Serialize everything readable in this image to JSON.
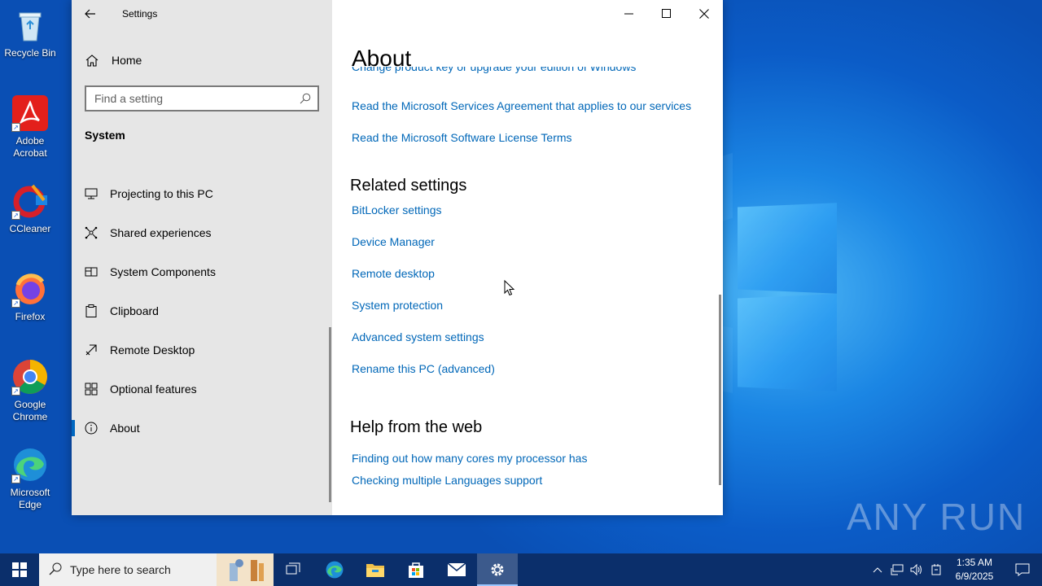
{
  "desktop": {
    "icons": [
      {
        "label": "Recycle Bin",
        "icon": "recycle-bin-icon"
      },
      {
        "label": "Adobe Acrobat",
        "icon": "adobe-acrobat-icon"
      },
      {
        "label": "CCleaner",
        "icon": "ccleaner-icon"
      },
      {
        "label": "Firefox",
        "icon": "firefox-icon"
      },
      {
        "label": "Google Chrome",
        "icon": "chrome-icon"
      },
      {
        "label": "Microsoft Edge",
        "icon": "edge-icon"
      }
    ],
    "watermark": "ANY RUN"
  },
  "settings": {
    "app_title": "Settings",
    "home_label": "Home",
    "search_placeholder": "Find a setting",
    "section": "System",
    "nav_items": [
      {
        "label": "Projecting to this PC",
        "icon": "projector-icon"
      },
      {
        "label": "Shared experiences",
        "icon": "shared-experiences-icon"
      },
      {
        "label": "System Components",
        "icon": "components-icon"
      },
      {
        "label": "Clipboard",
        "icon": "clipboard-icon"
      },
      {
        "label": "Remote Desktop",
        "icon": "remote-desktop-icon"
      },
      {
        "label": "Optional features",
        "icon": "optional-features-icon"
      },
      {
        "label": "About",
        "icon": "info-icon",
        "active": true
      }
    ],
    "page_title": "About",
    "cut_link": "Change product key or upgrade your edition of Windows",
    "top_links": [
      "Read the Microsoft Services Agreement that applies to our services",
      "Read the Microsoft Software License Terms"
    ],
    "related_heading": "Related settings",
    "related_links": [
      "BitLocker settings",
      "Device Manager",
      "Remote desktop",
      "System protection",
      "Advanced system settings",
      "Rename this PC (advanced)"
    ],
    "help_heading": "Help from the web",
    "help_links": [
      "Finding out how many cores my processor has",
      "Checking multiple Languages support"
    ]
  },
  "taskbar": {
    "search_text": "Type here to search",
    "apps": [
      "task-view-icon",
      "edge-icon",
      "file-explorer-icon",
      "store-icon",
      "mail-icon",
      "settings-gear-icon"
    ],
    "time": "1:35 AM",
    "date": "6/9/2025"
  },
  "colors": {
    "link": "#0067b8",
    "accent": "#0067c0",
    "taskbar": "#0b2f6b"
  }
}
